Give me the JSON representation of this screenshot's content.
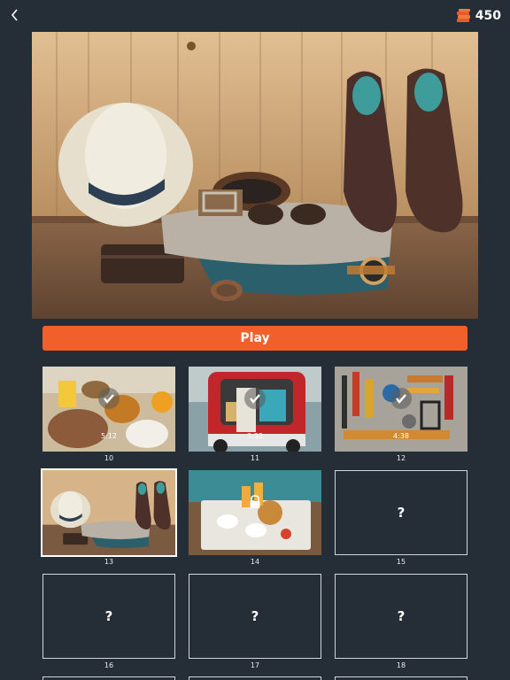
{
  "header": {
    "back_icon": "chevron-left-icon",
    "coin_icon": "coin-stack-icon",
    "coin_count": "450"
  },
  "hero": {
    "image_icon": "travel-flatlay-photo"
  },
  "play_button": {
    "label": "Play",
    "color": "#f15f2b"
  },
  "levels": [
    {
      "number": "10",
      "status": "completed",
      "time": "5:12",
      "thumbnail": "breakfast-photo"
    },
    {
      "number": "11",
      "status": "completed",
      "time": "3:33",
      "thumbnail": "red-car-trunk-photo"
    },
    {
      "number": "12",
      "status": "completed",
      "time": "4:38",
      "thumbnail": "tools-wall-photo"
    },
    {
      "number": "13",
      "status": "current",
      "thumbnail": "travel-flatlay-photo"
    },
    {
      "number": "14",
      "status": "preview-locked",
      "thumbnail": "breakfast-tray-photo"
    },
    {
      "number": "15",
      "status": "locked",
      "placeholder": "?"
    },
    {
      "number": "16",
      "status": "locked",
      "placeholder": "?"
    },
    {
      "number": "17",
      "status": "locked",
      "placeholder": "?"
    },
    {
      "number": "18",
      "status": "locked",
      "placeholder": "?"
    }
  ],
  "colors": {
    "background": "#252d36",
    "accent": "#f15f2b",
    "coin": "#e85a2a"
  }
}
